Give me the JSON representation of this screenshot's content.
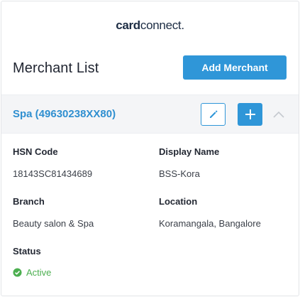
{
  "logo": {
    "part1": "card",
    "part2": "connect",
    "dot": "."
  },
  "header": {
    "title": "Merchant List",
    "add_button_label": "Add Merchant"
  },
  "merchant": {
    "name": "Spa (49630238XX80)",
    "expanded": true,
    "fields": {
      "hsn_code": {
        "label": "HSN Code",
        "value": "18143SC81434689"
      },
      "display_name": {
        "label": "Display Name",
        "value": "BSS-Kora"
      },
      "branch": {
        "label": "Branch",
        "value": "Beauty salon & Spa"
      },
      "location": {
        "label": "Location",
        "value": "Koramangala, Bangalore"
      },
      "status": {
        "label": "Status",
        "value": "Active"
      }
    }
  },
  "icons": {
    "edit": "pencil-icon",
    "add": "plus-icon",
    "collapse": "chevron-up-icon",
    "status": "check-circle-icon"
  },
  "colors": {
    "accent": "#2f96d8",
    "link": "#2f8fd0",
    "status_active": "#4caf50",
    "bar_bg": "#f4f5f7",
    "logo": "#1d2d44"
  }
}
